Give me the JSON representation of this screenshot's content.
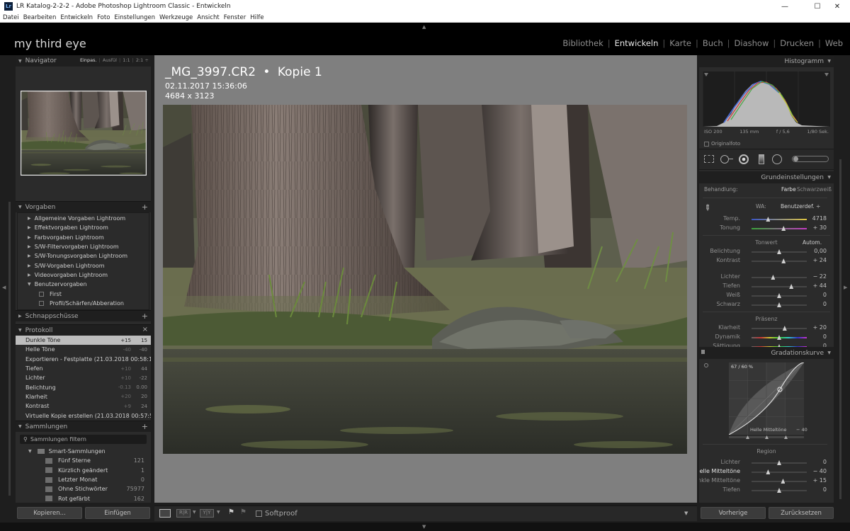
{
  "window": {
    "title": "LR Katalog-2-2-2 - Adobe Photoshop Lightroom Classic - Entwickeln",
    "app_icon": "Lr",
    "minimize": "—",
    "maximize": "☐",
    "close": "✕"
  },
  "menu": [
    "Datei",
    "Bearbeiten",
    "Entwickeln",
    "Foto",
    "Einstellungen",
    "Werkzeuge",
    "Ansicht",
    "Fenster",
    "Hilfe"
  ],
  "identity_plate": "my third eye",
  "modules": [
    {
      "label": "Bibliothek",
      "active": false
    },
    {
      "label": "Entwickeln",
      "active": true
    },
    {
      "label": "Karte",
      "active": false
    },
    {
      "label": "Buch",
      "active": false
    },
    {
      "label": "Diashow",
      "active": false
    },
    {
      "label": "Drucken",
      "active": false
    },
    {
      "label": "Web",
      "active": false
    }
  ],
  "navigator": {
    "title": "Navigator",
    "zooms": [
      "Einpas.",
      "Ausfül",
      "1:1",
      "2:1"
    ],
    "zoom_sep": "÷"
  },
  "presets": {
    "title": "Vorgaben",
    "folders": [
      "Allgemeine Vorgaben Lightroom",
      "Effektvorgaben Lightroom",
      "Farbvorgaben Lightroom",
      "S/W-Filtervorgaben Lightroom",
      "S/W-Tonungsvorgaben Lightroom",
      "S/W-Vorgaben Lightroom",
      "Videovorgaben Lightroom"
    ],
    "user_folder": "Benutzervorgaben",
    "user_items": [
      "First",
      "Profil/Schärfen/Abberation"
    ]
  },
  "snapshots": {
    "title": "Schnappschüsse"
  },
  "history": {
    "title": "Protokoll",
    "close": "×",
    "items": [
      {
        "name": "Dunkle Töne",
        "delta": "+15",
        "value": "15",
        "selected": true
      },
      {
        "name": "Helle Töne",
        "delta": "-40",
        "value": "-40"
      },
      {
        "name": "Exportieren - Festplatte (21.03.2018 00:58:19)",
        "delta": "",
        "value": ""
      },
      {
        "name": "Tiefen",
        "delta": "+10",
        "value": "44"
      },
      {
        "name": "Lichter",
        "delta": "+10",
        "value": "-22"
      },
      {
        "name": "Belichtung",
        "delta": "-0.13",
        "value": "0.00"
      },
      {
        "name": "Klarheit",
        "delta": "+20",
        "value": "20"
      },
      {
        "name": "Kontrast",
        "delta": "+9",
        "value": "24"
      },
      {
        "name": "Virtuelle Kopie erstellen (21.03.2018 00:57:51)",
        "delta": "",
        "value": ""
      }
    ]
  },
  "collections": {
    "title": "Sammlungen",
    "filter": "Sammlungen filtern",
    "smart": "Smart-Sammlungen",
    "items": [
      {
        "name": "Fünf Sterne",
        "count": "121"
      },
      {
        "name": "Kürzlich geändert",
        "count": "1"
      },
      {
        "name": "Letzter Monat",
        "count": "0"
      },
      {
        "name": "Ohne Stichwörter",
        "count": "75977"
      },
      {
        "name": "Rot gefärbt",
        "count": "162"
      }
    ]
  },
  "left_buttons": {
    "copy": "Kopieren...",
    "paste": "Einfügen"
  },
  "photo_info": {
    "filename": "_MG_3997.CR2",
    "copy": "Kopie 1",
    "bullet": "•",
    "date": "02.11.2017 15:36:06",
    "dimensions": "4684 x 3123"
  },
  "toolbar": {
    "softproof": "Softproof"
  },
  "histogram": {
    "title": "Histogramm",
    "iso": "ISO 200",
    "focal": "135 mm",
    "aperture": "f / 5,6",
    "shutter": "1/80 Sek.",
    "original": "Originalfoto"
  },
  "basic": {
    "title": "Grundeinstellungen",
    "treatment_label": "Behandlung:",
    "color": "Farbe",
    "bw": "Schwarzweiß",
    "wb_label": "WA:",
    "wb_value": "Benutzerdef.",
    "wb_arrow": "÷",
    "tone_label": "Tonwert",
    "auto": "Autom.",
    "presence": "Präsenz",
    "sliders": [
      {
        "label": "Temp.",
        "value": "4718",
        "pos": 0.3,
        "group": "wb"
      },
      {
        "label": "Tonung",
        "value": "+ 30",
        "pos": 0.58,
        "group": "wb"
      },
      {
        "label": "Belichtung",
        "value": "0,00",
        "pos": 0.5,
        "group": "tone"
      },
      {
        "label": "Kontrast",
        "value": "+ 24",
        "pos": 0.58,
        "group": "tone"
      },
      {
        "label": "Lichter",
        "value": "− 22",
        "pos": 0.39,
        "group": "tone2"
      },
      {
        "label": "Tiefen",
        "value": "+ 44",
        "pos": 0.72,
        "group": "tone2"
      },
      {
        "label": "Weiß",
        "value": "0",
        "pos": 0.5,
        "group": "tone2"
      },
      {
        "label": "Schwarz",
        "value": "0",
        "pos": 0.5,
        "group": "tone2"
      },
      {
        "label": "Klarheit",
        "value": "+ 20",
        "pos": 0.6,
        "group": "presence"
      },
      {
        "label": "Dynamik",
        "value": "0",
        "pos": 0.5,
        "group": "presence"
      },
      {
        "label": "Sättigung",
        "value": "0",
        "pos": 0.5,
        "group": "presence"
      }
    ]
  },
  "tone_curve": {
    "title": "Gradationskurve",
    "readout": "67 / 60 %",
    "channel": "Helle Mitteltöne",
    "channel_value": "− 40",
    "region": "Region",
    "sliders": [
      {
        "label": "Lichter",
        "value": "0",
        "pos": 0.5,
        "bright": false
      },
      {
        "label": "Helle Mitteltöne",
        "value": "− 40",
        "pos": 0.3,
        "bright": true
      },
      {
        "label": "Dunkle Mitteltöne",
        "value": "+ 15",
        "pos": 0.57,
        "bright": false
      },
      {
        "label": "Tiefen",
        "value": "0",
        "pos": 0.5,
        "bright": false
      }
    ]
  },
  "right_buttons": {
    "previous": "Vorherige",
    "reset": "Zurücksetzen"
  },
  "colors": {
    "accent": "#2f6fd1",
    "panel": "#2b2b2b",
    "header": "#1f1f1f",
    "background": "#7f7f7f"
  }
}
